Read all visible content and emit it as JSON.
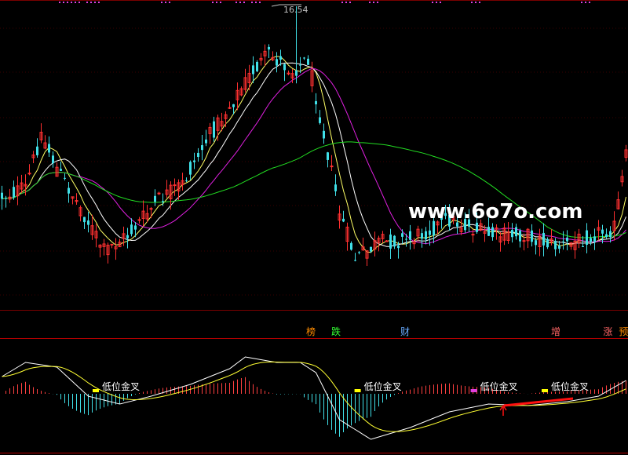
{
  "watermark": "www.6o7o.com",
  "chart_data": [
    {
      "type": "candlestick",
      "panel": "main",
      "max_price_label": "16.54",
      "ma_lines": [
        {
          "color": "#ffff66"
        },
        {
          "color": "#ffffff"
        },
        {
          "color": "#e020e0"
        },
        {
          "color": "#22dd22"
        }
      ],
      "candle_colors": {
        "up": "#ff3030",
        "down": "#40e0e8"
      },
      "tags": [
        {
          "text": "榜",
          "color": "#ff8c00",
          "pos": 0.495
        },
        {
          "text": "跌",
          "color": "#33ff33",
          "pos": 0.535
        },
        {
          "text": "财",
          "color": "#66aaff",
          "pos": 0.645
        },
        {
          "text": "增",
          "color": "#ff6666",
          "pos": 0.885
        },
        {
          "text": "涨",
          "color": "#ff6666",
          "pos": 0.968
        },
        {
          "text": "预",
          "color": "#ff8c00",
          "pos": 0.993
        }
      ]
    },
    {
      "type": "macd",
      "panel": "indicator",
      "signals": [
        {
          "text": "低位金叉",
          "marker_color": "#ffff00",
          "pos": 0.195
        },
        {
          "text": "低位金叉",
          "marker_color": "#ffff00",
          "pos": 0.612
        },
        {
          "text": "低位金叉",
          "marker_color": "#e040e0",
          "pos": 0.797
        },
        {
          "text": "低位金叉",
          "marker_color": "#ffff00",
          "pos": 0.91
        }
      ],
      "colors": {
        "pos_bar": "#ff4040",
        "neg_bar": "#40e0e8",
        "dif": "#ffffff",
        "dea": "#ffff33"
      }
    }
  ]
}
